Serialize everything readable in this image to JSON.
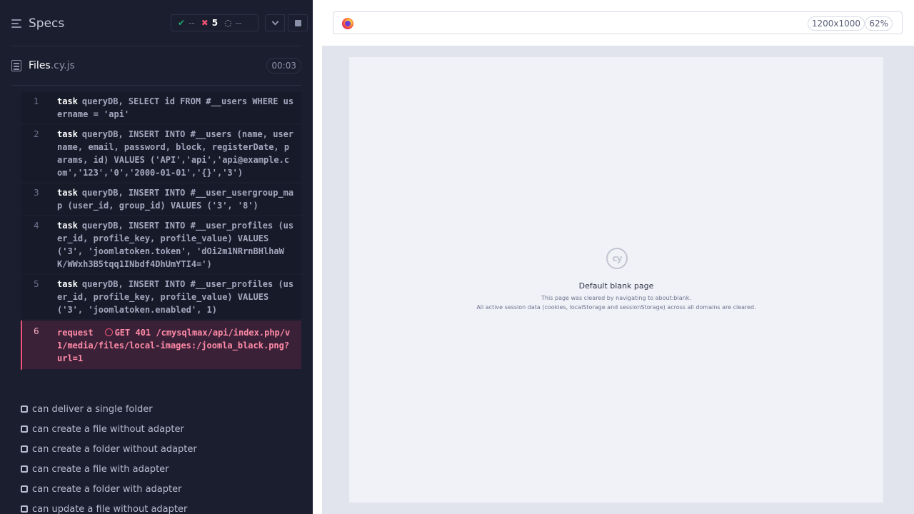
{
  "header": {
    "specs_label": "Specs",
    "stats": {
      "passed": "--",
      "failed": "5",
      "pending": "--"
    }
  },
  "file": {
    "name": "Files",
    "ext": ".cy.js",
    "timer": "00:03"
  },
  "commands": [
    {
      "num": "1",
      "name": "task",
      "message": "queryDB, SELECT id FROM #__users WHERE username = 'api'"
    },
    {
      "num": "2",
      "name": "task",
      "message": "queryDB, INSERT INTO #__users (name, username, email, password, block, registerDate, params, id) VALUES ('API','api','api@example.com','123','0','2000-01-01','{}','3')"
    },
    {
      "num": "3",
      "name": "task",
      "message": "queryDB, INSERT INTO #__user_usergroup_map (user_id, group_id) VALUES ('3', '8')"
    },
    {
      "num": "4",
      "name": "task",
      "message": "queryDB, INSERT INTO #__user_profiles (user_id, profile_key, profile_value) VALUES ('3', 'joomlatoken.token', 'dOi2m1NRrnBHlhaWK/WWxh3B5tqq1INbdf4DhUmYTI4=')"
    },
    {
      "num": "5",
      "name": "task",
      "message": "queryDB, INSERT INTO #__user_profiles (user_id, profile_key, profile_value) VALUES ('3', 'joomlatoken.enabled', 1)"
    }
  ],
  "error_command": {
    "num": "6",
    "name": "request",
    "message": "GET 401 /cmysqlmax/api/index.php/v1/media/files/local-images:/joomla_black.png?url=1"
  },
  "tests": [
    "can deliver a single folder",
    "can create a file without adapter",
    "can create a folder without adapter",
    "can create a file with adapter",
    "can create a folder with adapter",
    "can update a file without adapter"
  ],
  "browser": {
    "viewport": "1200x1000",
    "zoom": "62%"
  },
  "aut": {
    "logo_text": "cy",
    "title": "Default blank page",
    "line1": "This page was cleared by navigating to about:blank.",
    "line2": "All active session data (cookies, localStorage and sessionStorage) across all domains are cleared."
  },
  "colors": {
    "passed": "#1fa971",
    "failed": "#ee5475",
    "panel_bg": "#1b1e2e",
    "error_bg": "#3b2138"
  },
  "icons": {
    "specs": "hamburger-menu-icon",
    "file": "document-icon",
    "passed": "checkmark-icon",
    "failed": "x-icon",
    "pending": "spinner-icon",
    "browser": "firefox-icon"
  }
}
